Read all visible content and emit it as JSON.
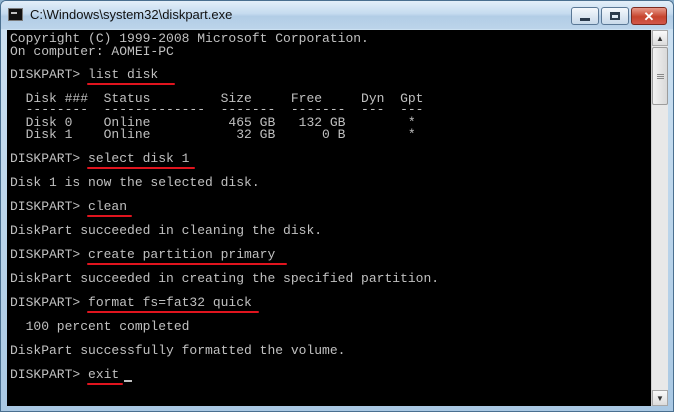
{
  "window": {
    "title": "C:\\Windows\\system32\\diskpart.exe"
  },
  "console": {
    "lines": [
      {
        "text": "Copyright (C) 1999-2008 Microsoft Corporation."
      },
      {
        "text": "On computer: AOMEI-PC"
      },
      {
        "text": "DISKPART> list disk"
      },
      {
        "text": "  Disk ###  Status         Size     Free     Dyn  Gpt"
      },
      {
        "text": "  --------  -------------  -------  -------  ---  ---"
      },
      {
        "text": "  Disk 0    Online          465 GB   132 GB        *"
      },
      {
        "text": "  Disk 1    Online           32 GB      0 B        *"
      },
      {
        "text": "DISKPART> select disk 1"
      },
      {
        "text": "Disk 1 is now the selected disk."
      },
      {
        "text": "DISKPART> clean"
      },
      {
        "text": "DiskPart succeeded in cleaning the disk."
      },
      {
        "text": "DISKPART> create partition primary"
      },
      {
        "text": "DiskPart succeeded in creating the specified partition."
      },
      {
        "text": "DISKPART> format fs=fat32 quick"
      },
      {
        "text": "  100 percent completed"
      },
      {
        "text": "DiskPart successfully formatted the volume."
      },
      {
        "text": "DISKPART> exit"
      }
    ]
  },
  "colors": {
    "console_bg": "#000000",
    "console_text": "#c0c0c0",
    "annotation_underline": "#e0141e"
  },
  "icons": [
    "console-app-icon",
    "minimize-icon",
    "maximize-icon",
    "close-icon",
    "scroll-up-icon",
    "scroll-down-icon"
  ]
}
